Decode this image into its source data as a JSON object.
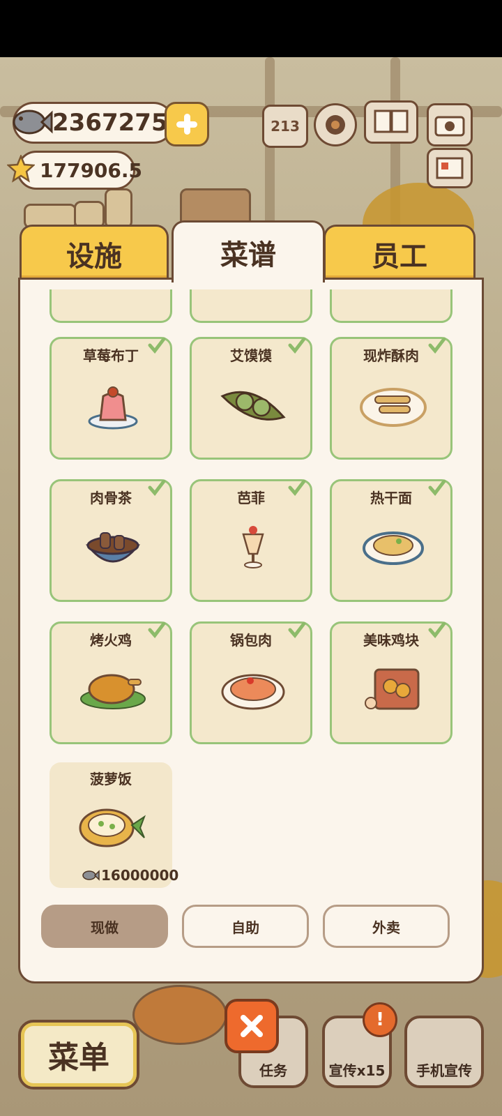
{
  "currency": {
    "fish": "2367275",
    "stars": "177906.5"
  },
  "tabs": [
    {
      "label": "设施",
      "active": false
    },
    {
      "label": "菜谱",
      "active": true
    },
    {
      "label": "员工",
      "active": false
    }
  ],
  "recipes": [
    {
      "name": "草莓布丁",
      "icon": "pudding-icon",
      "owned": true
    },
    {
      "name": "艾馍馍",
      "icon": "green-buns-icon",
      "owned": true
    },
    {
      "name": "现炸酥肉",
      "icon": "fried-pork-icon",
      "owned": true
    },
    {
      "name": "肉骨茶",
      "icon": "bak-kut-teh-icon",
      "owned": true
    },
    {
      "name": "芭菲",
      "icon": "parfait-icon",
      "owned": true
    },
    {
      "name": "热干面",
      "icon": "hot-dry-noodles-icon",
      "owned": true
    },
    {
      "name": "烤火鸡",
      "icon": "roast-turkey-icon",
      "owned": true
    },
    {
      "name": "锅包肉",
      "icon": "guobaorou-icon",
      "owned": true
    },
    {
      "name": "美味鸡块",
      "icon": "chicken-nuggets-icon",
      "owned": true
    },
    {
      "name": "菠萝饭",
      "icon": "pineapple-rice-icon",
      "owned": false,
      "price": "16000000"
    }
  ],
  "modes": [
    {
      "label": "现做",
      "selected": true
    },
    {
      "label": "自助",
      "selected": false
    },
    {
      "label": "外卖",
      "selected": false
    }
  ],
  "bottom": {
    "menu_label": "菜单",
    "task_label": "任务",
    "promo_label": "宣传x15",
    "phone_promo_label": "手机宣传",
    "badge": "!"
  },
  "colors": {
    "tab_yellow": "#f7c94b",
    "card_border": "#98c479",
    "selected_mode": "#b69c86",
    "close_orange": "#ee6a2d"
  }
}
